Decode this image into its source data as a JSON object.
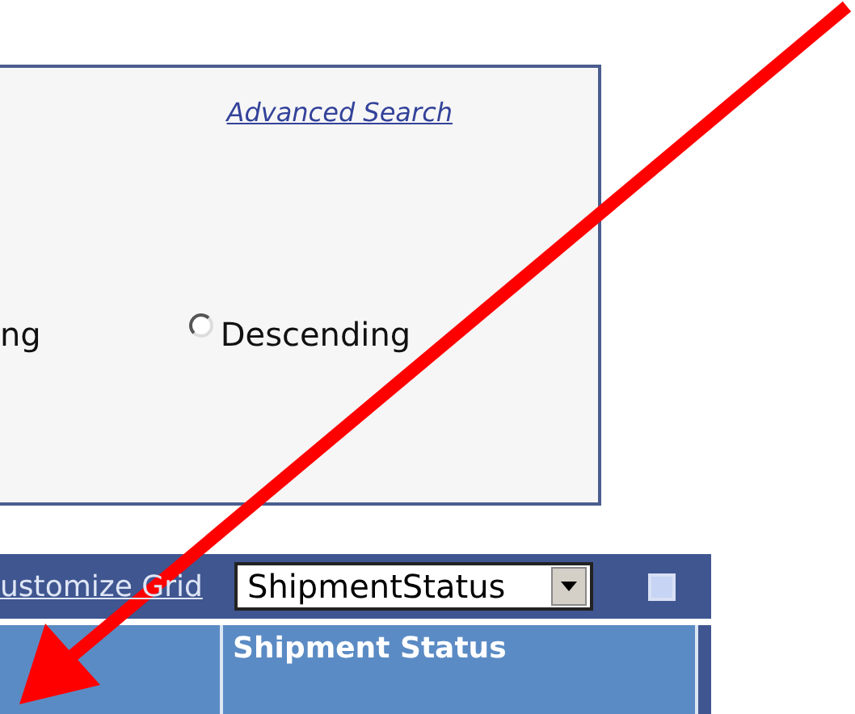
{
  "search_panel": {
    "advanced_search_link": "Advanced Search",
    "sort_options": [
      {
        "label": "ng"
      },
      {
        "label": "Descending",
        "selected": false
      }
    ]
  },
  "grid": {
    "toolbar": {
      "customize_link": "ustomize Grid",
      "column_select": {
        "value": "ShipmentStatus"
      }
    },
    "columns": [
      {},
      {
        "label": "Shipment Status"
      }
    ]
  }
}
